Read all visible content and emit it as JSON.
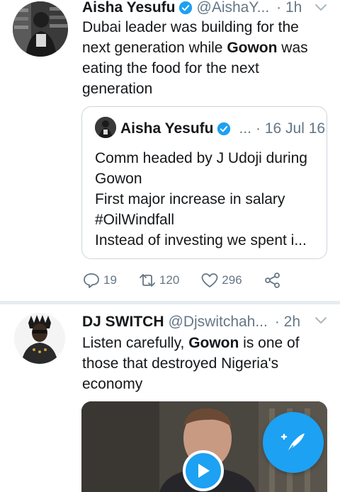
{
  "tweets": [
    {
      "name": "Aisha Yesufu",
      "handle": "@AishaY...",
      "time": "· 1h",
      "verified": true,
      "text_parts": [
        "Dubai leader was building for the next generation while ",
        "Gowon",
        " was eating the food for the next generation"
      ],
      "quote": {
        "name": "Aisha Yesufu",
        "handle": "...",
        "time": "· 16 Jul 16",
        "lines": [
          "Comm headed by J Udoji during",
          "Gowon",
          "First major increase in salary",
          "#OilWindfall",
          "Instead of investing we spent i..."
        ]
      },
      "actions": {
        "replies": "19",
        "retweets": "120",
        "likes": "296"
      }
    },
    {
      "name": "DJ SWITCH",
      "handle": "@Djswitchah...",
      "time": "· 2h",
      "verified": false,
      "text_parts": [
        "Listen carefully, ",
        "Gowon",
        " is one of those that destroyed Nigeria's economy"
      ]
    }
  ],
  "icons": {
    "reply": "reply-icon",
    "retweet": "retweet-icon",
    "like": "heart-icon",
    "share": "share-icon",
    "verified": "verified-badge-icon",
    "caret": "chevron-down-icon",
    "play": "play-icon",
    "compose": "compose-tweet-icon"
  },
  "colors": {
    "accent": "#1da1f2",
    "text": "#14171a",
    "secondary": "#657786",
    "border": "#ccd6dd",
    "divider": "#e6ecf0"
  }
}
